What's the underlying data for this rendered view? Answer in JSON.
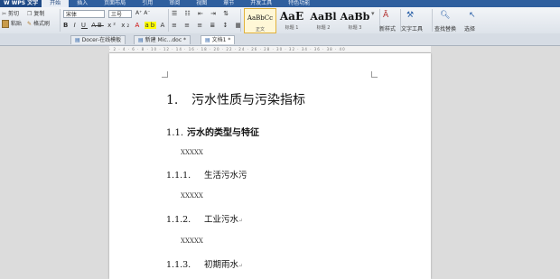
{
  "menubar": {
    "app": "W WPS 文字",
    "items": [
      "开始",
      "插入",
      "页面布局",
      "引用",
      "审阅",
      "视图",
      "章节",
      "开发工具",
      "特色功能"
    ]
  },
  "ribbon": {
    "cut": "剪切",
    "copy": "复制",
    "paste": "粘贴",
    "format_painter": "格式刷",
    "font_name": "宋体",
    "font_size": "三号",
    "styles": [
      {
        "preview": "AaBbCc",
        "label": "正文"
      },
      {
        "preview": "AaE",
        "label": "标题 1"
      },
      {
        "preview": "AaBl",
        "label": "标题 2"
      },
      {
        "preview": "AaBb",
        "label": "标题 3"
      }
    ],
    "new_style": "新样式",
    "text_tools": "文字工具",
    "find_replace": "查找替换",
    "select": "选择"
  },
  "tabs": [
    "Docer-在线模板",
    "新建 Mic...doc *",
    "文档1 *"
  ],
  "ruler": "· 2 · 4 · 6 · 8 · 10 · 12 · 14 · 16 · 18 · 20 · 22 · 24 · 26 · 28 · 30 · 32 · 34 · 36 · 38 · 40",
  "document": {
    "h1": {
      "num": "1.",
      "text": "污水性质与污染指标"
    },
    "h2": {
      "num": "1.1.",
      "text": "污水的类型与特征"
    },
    "p1": "XXXXX",
    "h3a": {
      "num": "1.1.1.",
      "text": "生活污水污"
    },
    "p2": "XXXXX",
    "h3b": {
      "num": "1.1.2.",
      "text": "工业污水"
    },
    "p3": "XXXXX",
    "h3c": {
      "num": "1.1.3.",
      "text": "初期雨水"
    }
  }
}
